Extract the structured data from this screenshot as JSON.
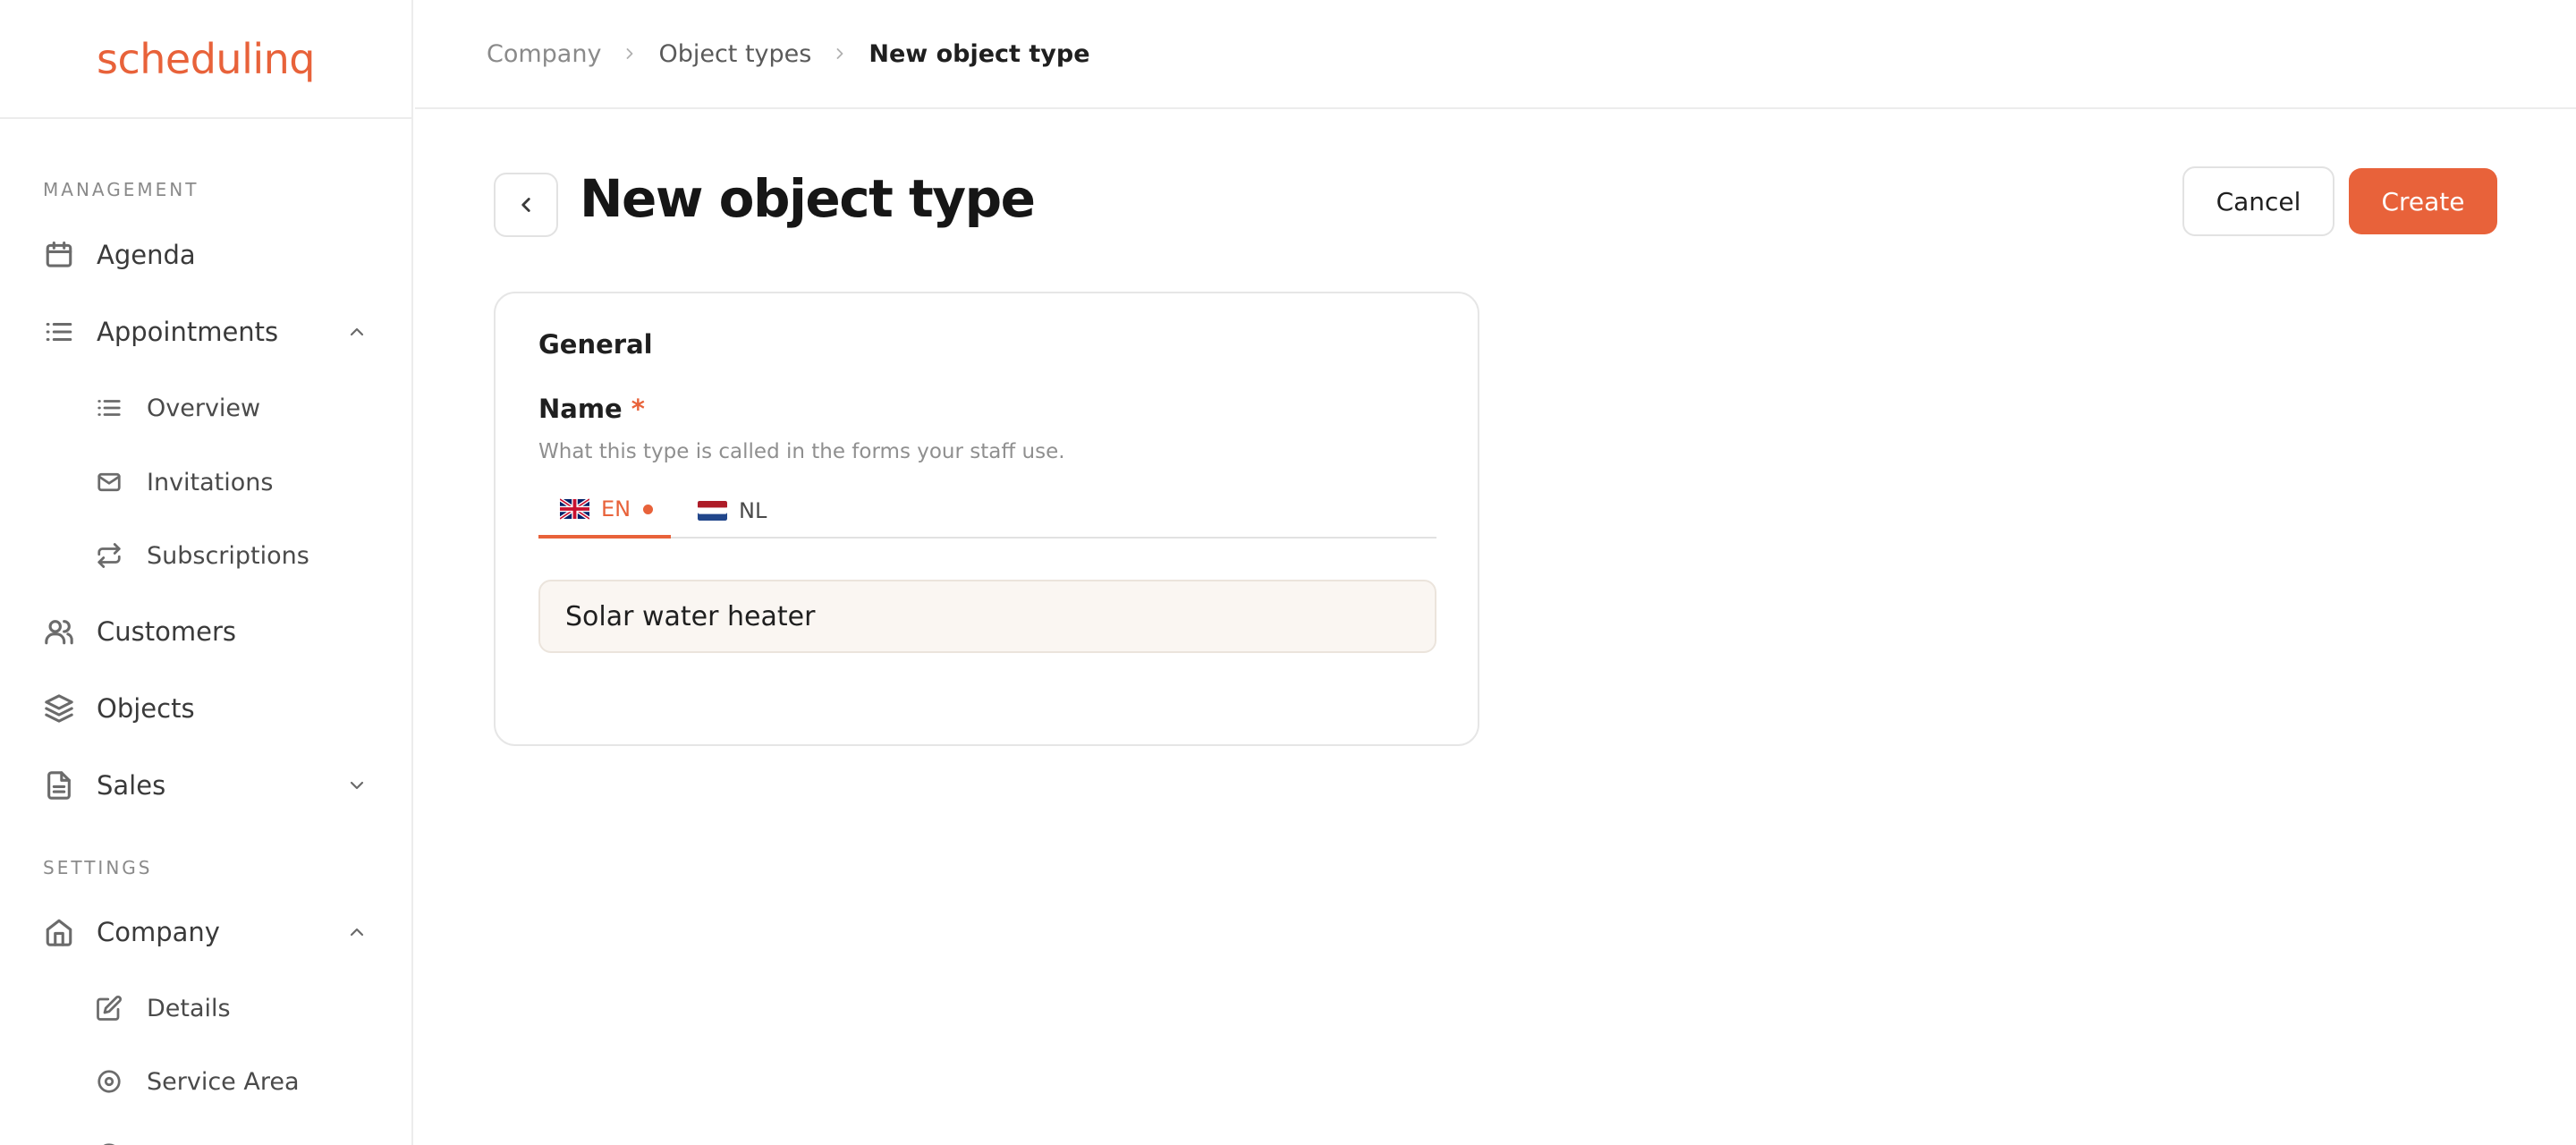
{
  "app": {
    "logo": "schedulinq"
  },
  "sidebar": {
    "management_label": "MANAGEMENT",
    "settings_label": "SETTINGS",
    "items": {
      "agenda": "Agenda",
      "appointments": "Appointments",
      "overview": "Overview",
      "invitations": "Invitations",
      "subscriptions": "Subscriptions",
      "customers": "Customers",
      "objects": "Objects",
      "sales": "Sales",
      "company": "Company",
      "details": "Details",
      "service_area": "Service Area"
    }
  },
  "breadcrumb": {
    "items": [
      "Company",
      "Object types",
      "New object type"
    ]
  },
  "page": {
    "title": "New object type",
    "cancel_label": "Cancel",
    "create_label": "Create"
  },
  "form": {
    "section_title": "General",
    "name_label": "Name",
    "required_mark": "*",
    "name_help": "What this type is called in the forms your staff use.",
    "languages": [
      {
        "code": "EN",
        "active": true
      },
      {
        "code": "NL",
        "active": false
      }
    ],
    "name_value": "Solar water heater"
  },
  "colors": {
    "accent": "#e8623a",
    "input_bg": "#faf6f2",
    "border": "#ececec"
  }
}
